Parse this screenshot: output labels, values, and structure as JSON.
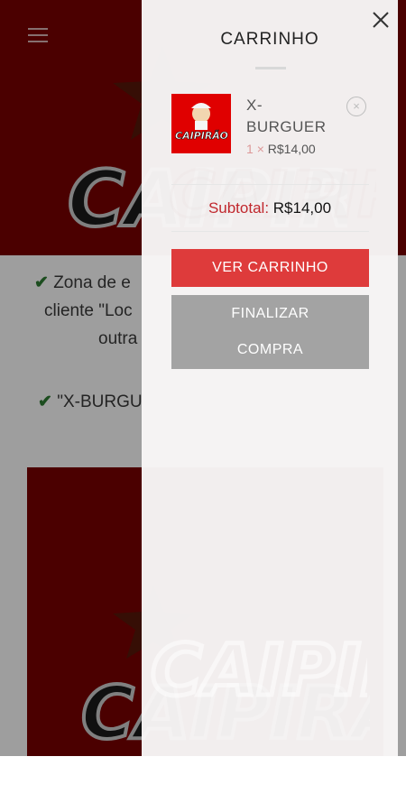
{
  "background": {
    "menu_icon": "hamburger-icon",
    "line1": "Zona de e",
    "line2": "cliente \"Loc",
    "line3": "outra",
    "line4": "\"X-BURGU",
    "check_icon": "check-icon",
    "logo_text": "CAIPIRÃO"
  },
  "cart": {
    "title": "CARRINHO",
    "close_icon": "close-icon",
    "items": [
      {
        "name_line1": "X-",
        "name_line2": "BURGUER",
        "quantity": "1",
        "multiply": "×",
        "price": "R$14,00",
        "remove_icon": "remove-circle-icon",
        "thumb_logo": "CAIPIRÃO"
      }
    ],
    "subtotal_label": "Subtotal:",
    "subtotal_value": "R$14,00",
    "view_cart_label": "VER CARRINHO",
    "checkout_line1": "FINALIZAR",
    "checkout_line2": "COMPRA"
  },
  "colors": {
    "brand_red": "#de3b3b",
    "dark_red": "#7a0000",
    "gray_button": "#a3a3a3"
  }
}
